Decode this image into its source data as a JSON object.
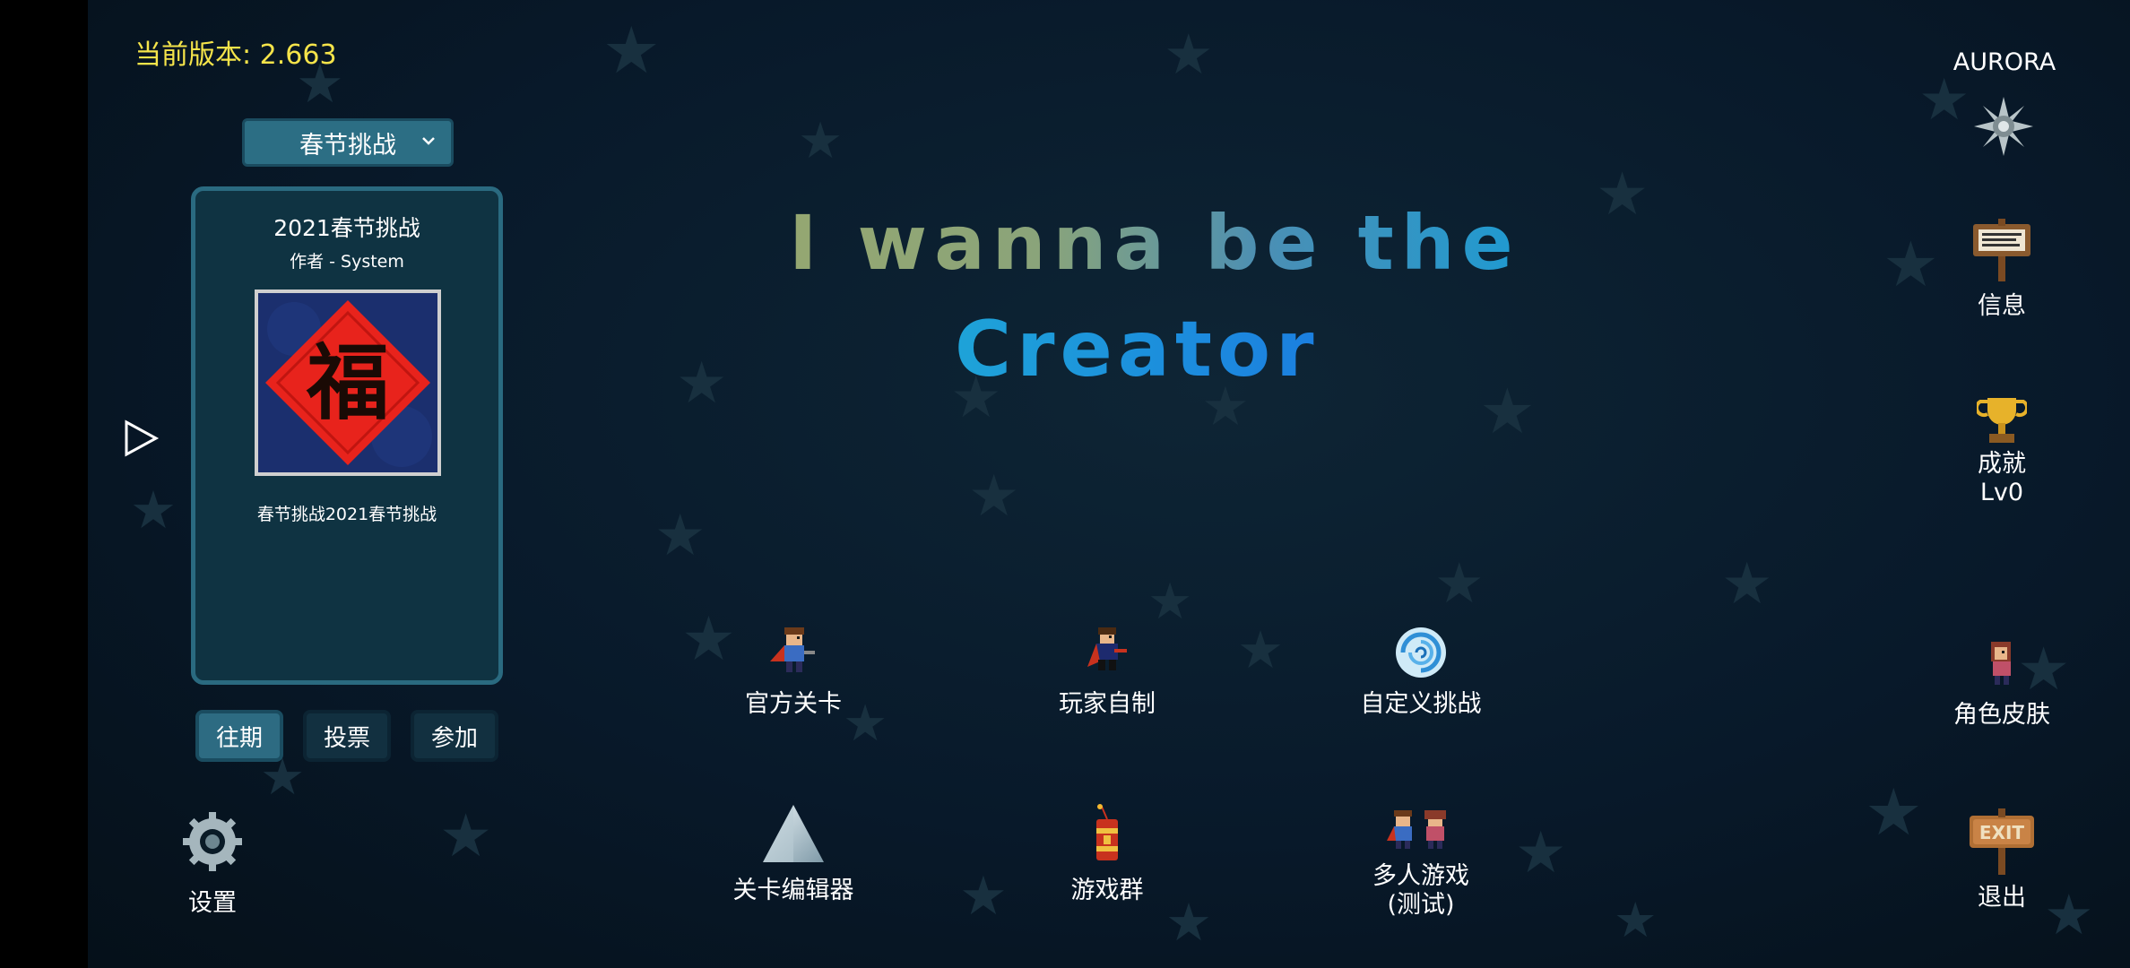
{
  "version_text": "当前版本: 2.663",
  "mode_selector": {
    "value": "春节挑战"
  },
  "challenge_card": {
    "title": "2021春节挑战",
    "author": "作者 - System",
    "thumb_glyph": "福",
    "description": "春节挑战2021春节挑战"
  },
  "tabs": [
    "往期",
    "投票",
    "参加"
  ],
  "game_title": {
    "line1": "I wanna be the",
    "line2": "Creator"
  },
  "main_menu": {
    "official_levels": "官方关卡",
    "player_made": "玩家自制",
    "custom_challenge": "自定义挑战",
    "level_editor": "关卡编辑器",
    "game_group": "游戏群",
    "multiplayer_line1": "多人游戏",
    "multiplayer_line2": "(测试)"
  },
  "settings_label": "设置",
  "right_menu": {
    "username": "AURORA",
    "info": "信息",
    "achievements": "成就",
    "achievement_level": "Lv0",
    "skins": "角色皮肤",
    "exit": "退出",
    "exit_sign_text": "EXIT"
  },
  "colors": {
    "version_text": "#f5e44a",
    "accent_panel": "#2a6a80",
    "title_gradient_start": "#95a771",
    "title_gradient_end": "#1b7fe0"
  }
}
